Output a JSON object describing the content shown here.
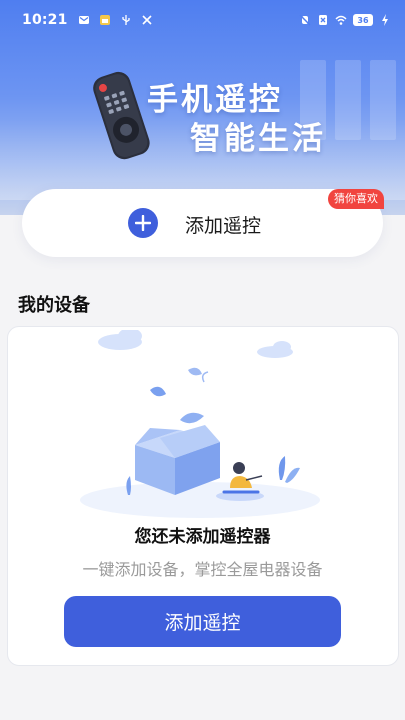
{
  "status_bar": {
    "time": "10:21",
    "battery": "36"
  },
  "banner": {
    "line1": "手机遥控",
    "line2": "智能生活"
  },
  "add_card": {
    "label": "添加遥控",
    "tag": "猜你喜欢"
  },
  "devices": {
    "section_title": "我的设备",
    "empty_title": "您还未添加遥控器",
    "empty_subtitle": "一键添加设备，掌控全屋电器设备",
    "button_label": "添加遥控"
  },
  "colors": {
    "accent": "#3f5fdc",
    "tag": "#f1443f",
    "hero_top": "#4f7ef0"
  }
}
